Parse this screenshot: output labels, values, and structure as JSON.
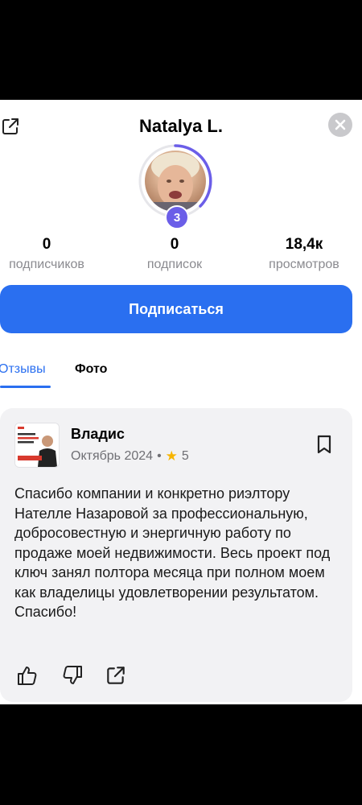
{
  "profile": {
    "name": "Natalya L.",
    "level": "3"
  },
  "stats": [
    {
      "value": "0",
      "label": "подписчиков"
    },
    {
      "value": "0",
      "label": "подписок"
    },
    {
      "value": "18,4к",
      "label": "просмотров"
    }
  ],
  "subscribe_label": "Подписаться",
  "tabs": [
    {
      "label": "Отзывы",
      "active": true
    },
    {
      "label": "Фото",
      "active": false
    }
  ],
  "review": {
    "author": "Владис",
    "date": "Октябрь 2024",
    "separator": "•",
    "rating": "5",
    "text": "Спасибо компании и конкретно риэлтору Нателле Назаровой за профессиональную, добросовестную и энергичную работу по продаже моей недвижимости. Весь проект под ключ занял полтора месяца при полном моем как владелицы удовлетворении результатом. Спасибо!"
  },
  "icons": {
    "share": "share-icon",
    "close": "close-icon",
    "bookmark": "bookmark-icon",
    "like": "thumbs-up-icon",
    "dislike": "thumbs-down-icon",
    "star": "star-icon"
  },
  "colors": {
    "accent": "#2a6ff0",
    "badge": "#6b5ee8",
    "star": "#f7b500",
    "card": "#f2f2f4"
  }
}
